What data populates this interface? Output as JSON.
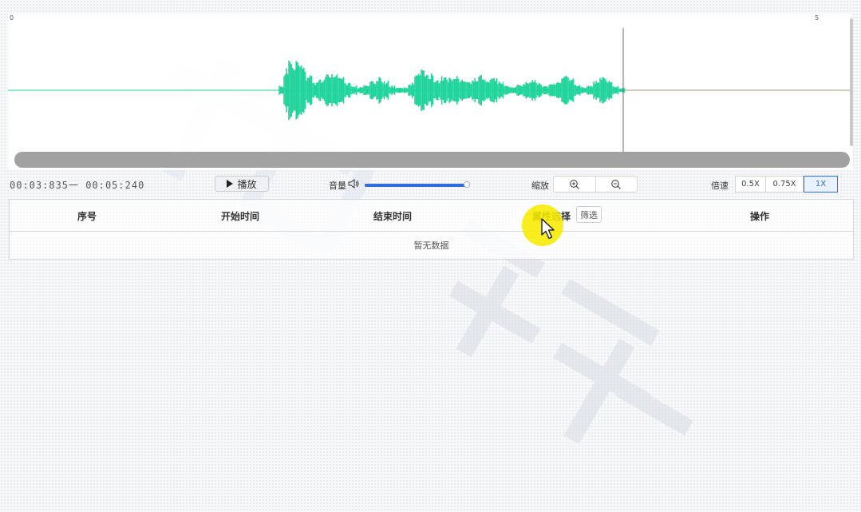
{
  "timeline": {
    "tick_start": "0",
    "tick_end": "5"
  },
  "colors": {
    "waveform": "#1ed49a",
    "accent": "#2d6fe0",
    "cursor_highlight": "#f6ea00"
  },
  "controls": {
    "time_start": "00:03:835",
    "time_separator": "一",
    "time_end": "00:05:240",
    "play_label": "播放",
    "volume_label": "音量",
    "volume_level": 0.97,
    "zoom_label": "缩放",
    "speed_label": "倍速",
    "speeds": [
      "0.5X",
      "0.75X",
      "1X"
    ],
    "active_speed": "1X"
  },
  "table": {
    "columns": [
      "序号",
      "开始时间",
      "结束时间",
      "属性选择",
      "操作"
    ],
    "filter_label": "筛选",
    "empty_text": "暂无数据"
  },
  "icons": {
    "play": "play-icon",
    "speaker": "speaker-icon",
    "zoom_in": "zoom-in-icon",
    "zoom_out": "zoom-out-icon",
    "cursor": "mouse-pointer-icon"
  }
}
